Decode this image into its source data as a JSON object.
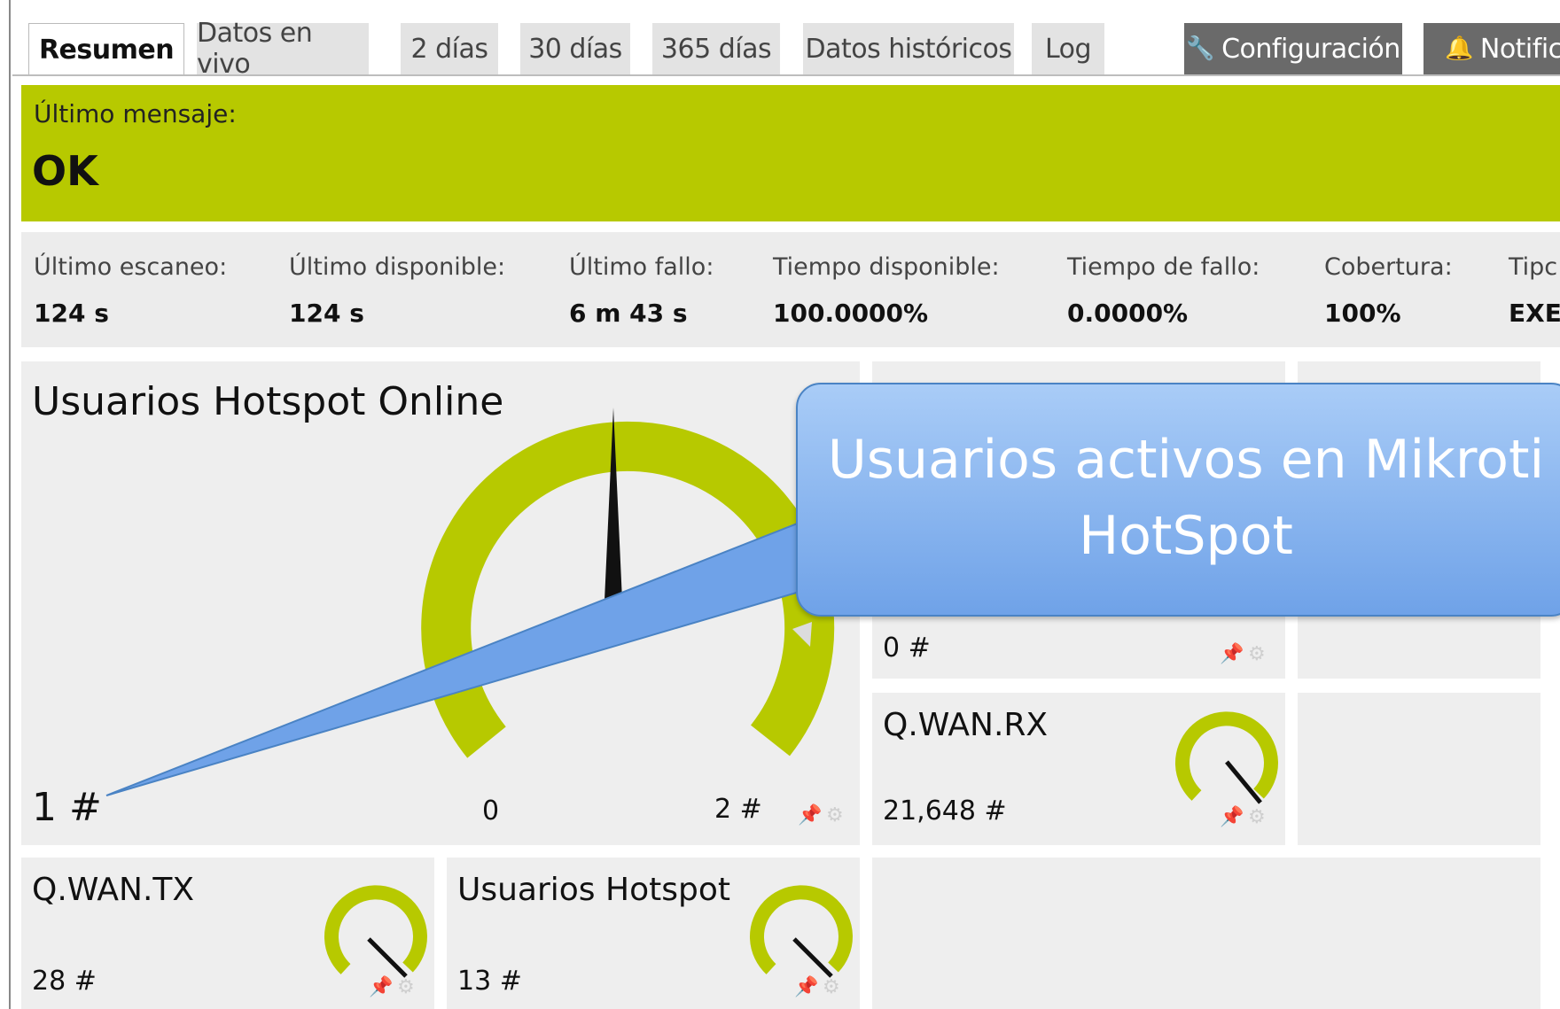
{
  "tabs": [
    {
      "label": "Resumen",
      "active": true
    },
    {
      "label": "Datos en vivo"
    },
    {
      "label": "2 días"
    },
    {
      "label": "30 días"
    },
    {
      "label": "365 días"
    },
    {
      "label": "Datos históricos"
    },
    {
      "label": "Log"
    },
    {
      "label": "Configuración",
      "icon": "wrench-icon"
    },
    {
      "label": "Notifica",
      "icon": "bell-icon"
    }
  ],
  "status": {
    "label": "Último mensaje:",
    "message": "OK",
    "color": "#b7c900"
  },
  "stats": [
    {
      "label": "Último escaneo:",
      "value": "124 s"
    },
    {
      "label": "Último disponible:",
      "value": "124 s"
    },
    {
      "label": "Último fallo:",
      "value": "6 m 43 s"
    },
    {
      "label": "Tiempo disponible:",
      "value": "100.0000%"
    },
    {
      "label": "Tiempo de fallo:",
      "value": "0.0000%"
    },
    {
      "label": "Cobertura:",
      "value": "100%"
    },
    {
      "label": "Tipc",
      "value": "EXE"
    }
  ],
  "main_gauge": {
    "title": "Usuarios Hotspot Online",
    "value": "1 #",
    "min_label": "0",
    "max_label": "2 #",
    "fraction": 0.5
  },
  "small_gauges": [
    {
      "id": "hidden",
      "title": "",
      "value": "0 #"
    },
    {
      "id": "wan-rx",
      "title": "Q.WAN.RX",
      "value": "21,648 #"
    },
    {
      "id": "wan-tx",
      "title": "Q.WAN.TX",
      "value": "28 #"
    },
    {
      "id": "hotspot",
      "title": "Usuarios Hotspot",
      "value": "13 #"
    }
  ],
  "callout": {
    "line1": "Usuarios activos en Mikroti",
    "line2": "HotSpot"
  },
  "colors": {
    "gauge": "#b7c900",
    "callout": "#6fa2e8"
  }
}
